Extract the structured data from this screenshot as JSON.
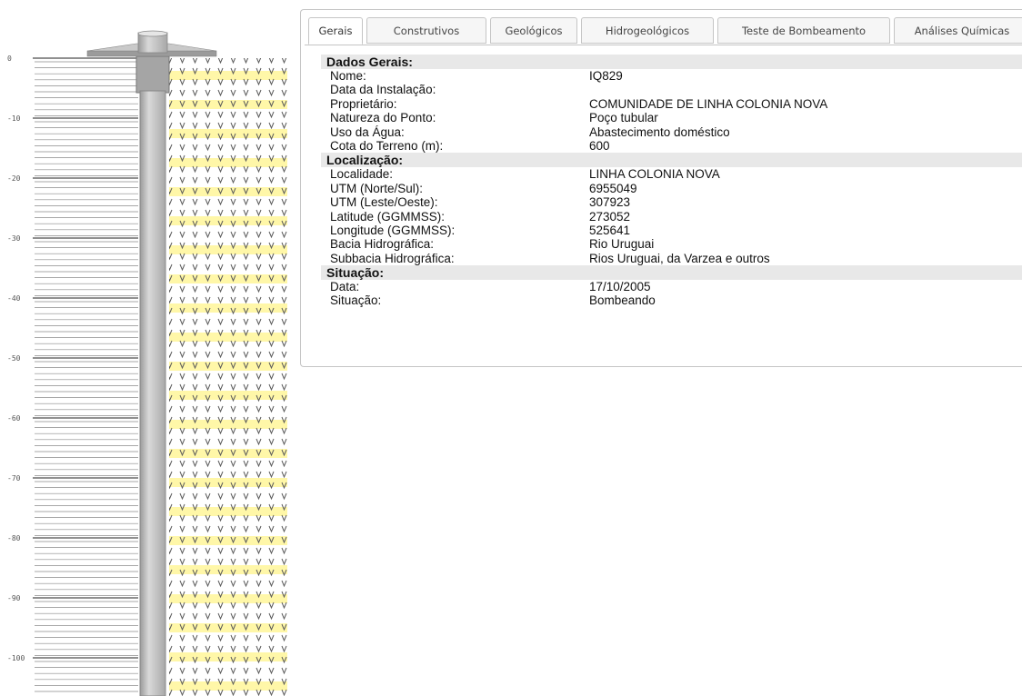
{
  "profile": {
    "depth_labels": [
      "0",
      "-10",
      "-20",
      "-30",
      "-40",
      "-50",
      "-60",
      "-70",
      "-80",
      "-90",
      "-100"
    ],
    "colors": {
      "casing": "#bdbdbd",
      "rock_hatch": "#777777",
      "rock_pattern": "#5a5a5a",
      "highlight": "#fff7a8"
    }
  },
  "tabs": [
    {
      "label": "Gerais",
      "active": true
    },
    {
      "label": "Construtivos",
      "active": false
    },
    {
      "label": "Geológicos",
      "active": false
    },
    {
      "label": "Hidrogeológicos",
      "active": false
    },
    {
      "label": "Teste de Bombeamento",
      "active": false
    },
    {
      "label": "Análises Químicas",
      "active": false
    }
  ],
  "sections": [
    {
      "title": "Dados Gerais:",
      "rows": [
        {
          "label": "Nome:",
          "value": "IQ829"
        },
        {
          "label": "Data da Instalação:",
          "value": ""
        },
        {
          "label": "Proprietário:",
          "value": "COMUNIDADE DE LINHA COLONIA NOVA"
        },
        {
          "label": "Natureza do Ponto:",
          "value": "Poço tubular"
        },
        {
          "label": "Uso da Água:",
          "value": "Abastecimento doméstico"
        },
        {
          "label": "Cota do Terreno (m):",
          "value": "600"
        }
      ]
    },
    {
      "title": "Localização:",
      "rows": [
        {
          "label": "Localidade:",
          "value": "LINHA COLONIA NOVA"
        },
        {
          "label": "UTM (Norte/Sul):",
          "value": "6955049"
        },
        {
          "label": "UTM (Leste/Oeste):",
          "value": "307923"
        },
        {
          "label": "Latitude (GGMMSS):",
          "value": "273052"
        },
        {
          "label": "Longitude (GGMMSS):",
          "value": "525641"
        },
        {
          "label": "Bacia Hidrográfica:",
          "value": "Rio Uruguai"
        },
        {
          "label": "Subbacia Hidrográfica:",
          "value": "Rios Uruguai, da Varzea e outros"
        }
      ]
    },
    {
      "title": "Situação:",
      "rows": [
        {
          "label": "Data:",
          "value": "17/10/2005"
        },
        {
          "label": "Situação:",
          "value": "Bombeando"
        }
      ]
    }
  ]
}
